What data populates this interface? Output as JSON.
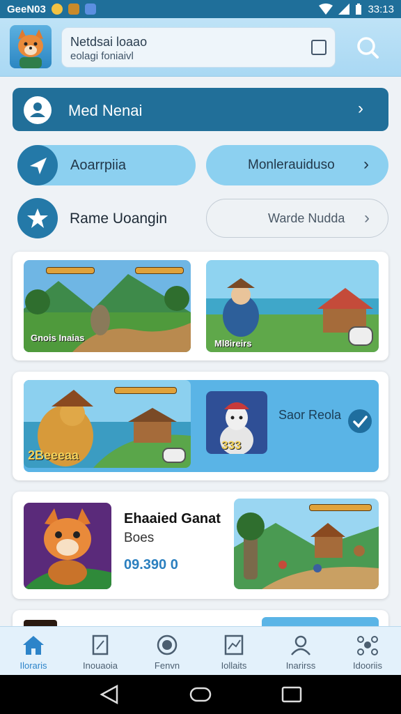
{
  "status_bar": {
    "carrier": "GeeN03",
    "time": "33:13"
  },
  "header": {
    "search_line1": "Netdsai loaao",
    "search_line2": "eolagi foniaivl"
  },
  "menu": {
    "main_label": "Med Nenai",
    "pill_left": "Aoarrpiia",
    "pill_right": "Monlerauiduso",
    "row3_label": "Rame Uoangin",
    "row3_pill": "Warde Nudda"
  },
  "cards": {
    "card1": {
      "thumb1_caption": "Gnois Inaias",
      "thumb2_caption": "Ml8ireirs"
    },
    "card2": {
      "thumb_caption": "2Beeeaa",
      "badge_number": "333",
      "label": "Saor Reola"
    },
    "card3": {
      "title": "Ehaaied Ganat",
      "subtitle": "Boes",
      "price": "09.390 0"
    }
  },
  "bottom_nav": [
    {
      "label": "Iloraris",
      "icon": "home-icon",
      "active": true
    },
    {
      "label": "Inouaoia",
      "icon": "book-icon",
      "active": false
    },
    {
      "label": "Fenvn",
      "icon": "globe-icon",
      "active": false
    },
    {
      "label": "Iollaits",
      "icon": "chart-icon",
      "active": false
    },
    {
      "label": "Inarirss",
      "icon": "users-icon",
      "active": false
    },
    {
      "label": "Idooriis",
      "icon": "network-icon",
      "active": false
    }
  ],
  "colors": {
    "accent": "#216f99",
    "pill": "#8cd0f0",
    "active_nav": "#2d84c9"
  }
}
